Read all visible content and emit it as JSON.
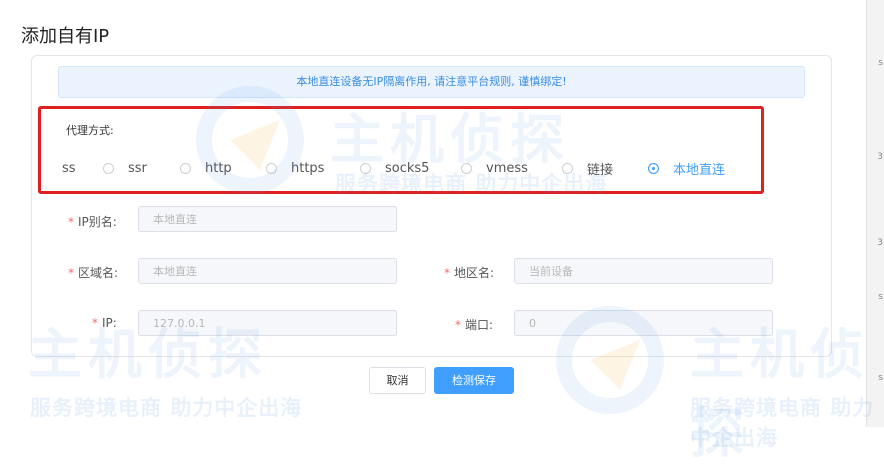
{
  "dialog": {
    "title": "添加自有IP"
  },
  "notice": {
    "text": "本地直连设备无IP隔离作用, 请注意平台规则, 谨慎绑定!"
  },
  "proxy": {
    "label": "代理方式:",
    "options": [
      "ss",
      "ssr",
      "http",
      "https",
      "socks5",
      "vmess",
      "链接",
      "本地直连"
    ],
    "selected": "本地直连"
  },
  "form": {
    "ip_alias": {
      "label": "IP别名:",
      "value": "本地直连"
    },
    "region_name": {
      "label": "区域名:",
      "value": "本地直连"
    },
    "area_name": {
      "label": "地区名:",
      "value": "当前设备"
    },
    "ip": {
      "label": "IP:",
      "value": "127.0.0.1"
    },
    "port": {
      "label": "端口:",
      "value": "0"
    }
  },
  "buttons": {
    "cancel": "取消",
    "save": "检测保存"
  },
  "watermark": {
    "brand": "主机侦探",
    "slogan": "服务跨境电商 助力中企出海"
  },
  "colors": {
    "accent": "#409eff",
    "highlight": "#e02020",
    "required": "#f56c6c"
  }
}
